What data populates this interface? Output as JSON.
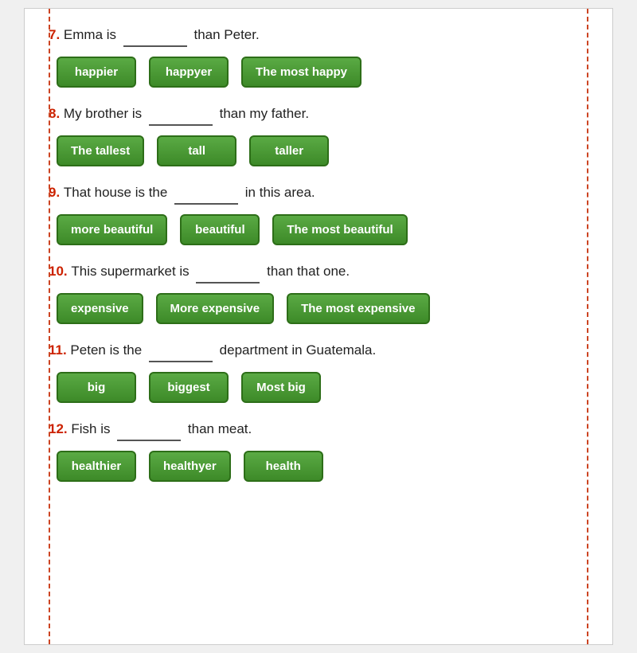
{
  "questions": [
    {
      "id": "q7",
      "number": "7.",
      "prefix": "Emma is",
      "blank": "________",
      "suffix": "than Peter.",
      "options": [
        "happier",
        "happyer",
        "The most happy"
      ]
    },
    {
      "id": "q8",
      "number": "8.",
      "prefix": "My brother is",
      "blank": "_______",
      "suffix": "than my father.",
      "options": [
        "The tallest",
        "tall",
        "taller"
      ]
    },
    {
      "id": "q9",
      "number": "9.",
      "prefix": "That house is the",
      "blank": "_________",
      "suffix": "in this area.",
      "options": [
        "more beautiful",
        "beautiful",
        "The most beautiful"
      ]
    },
    {
      "id": "q10",
      "number": "10.",
      "prefix": "This supermarket is",
      "blank": "______",
      "suffix": "than that one.",
      "options": [
        "expensive",
        "More expensive",
        "The most expensive"
      ]
    },
    {
      "id": "q11",
      "number": "11.",
      "prefix": "Peten is the",
      "blank": "__________",
      "suffix": "department in Guatemala.",
      "options": [
        "big",
        "biggest",
        "Most big"
      ]
    },
    {
      "id": "q12",
      "number": "12.",
      "prefix": "Fish is",
      "blank": "___________",
      "suffix": "than meat.",
      "options": [
        "healthier",
        "healthyer",
        "health"
      ]
    }
  ]
}
